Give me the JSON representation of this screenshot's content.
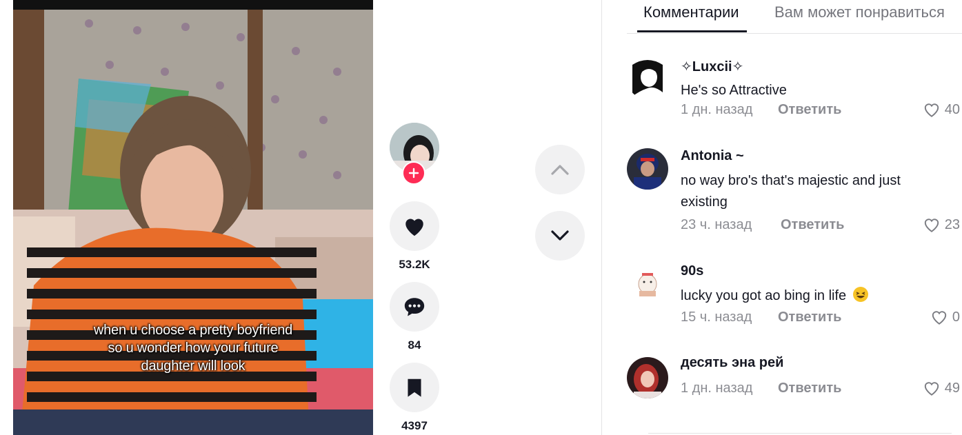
{
  "video": {
    "caption_lines": [
      "when u choose a pretty boyfriend",
      "so u wonder how your future",
      "daughter will look"
    ]
  },
  "actions": {
    "likes": "53.2K",
    "comments": "84",
    "saves": "4397"
  },
  "tabs": {
    "comments": "Комментарии",
    "you_may_like": "Вам может понравиться"
  },
  "comments": [
    {
      "user": "✧Luxcii✧",
      "text": "He's so Attractive",
      "time": "1 дн. назад",
      "reply": "Ответить",
      "likes": "40"
    },
    {
      "user": "Antonia ~",
      "text": "no way bro's that's majestic and just existing",
      "time": "23 ч. назад",
      "reply": "Ответить",
      "likes": "23"
    },
    {
      "user": "90s",
      "text": "lucky you got ao bing in life",
      "time": "15 ч. назад",
      "reply": "Ответить",
      "likes": "0"
    },
    {
      "user": "десять эна рей",
      "text": "",
      "time": "1 дн. назад",
      "reply": "Ответить",
      "likes": "49"
    }
  ],
  "colors": {
    "accent": "#fe2c55",
    "button_bg": "#f1f1f2",
    "text": "#161823"
  },
  "icons": [
    "plus-icon",
    "heart-icon",
    "comment-icon",
    "bookmark-icon",
    "chevron-up-icon",
    "chevron-down-icon",
    "heart-outline-icon",
    "laughing-emoji-icon"
  ]
}
